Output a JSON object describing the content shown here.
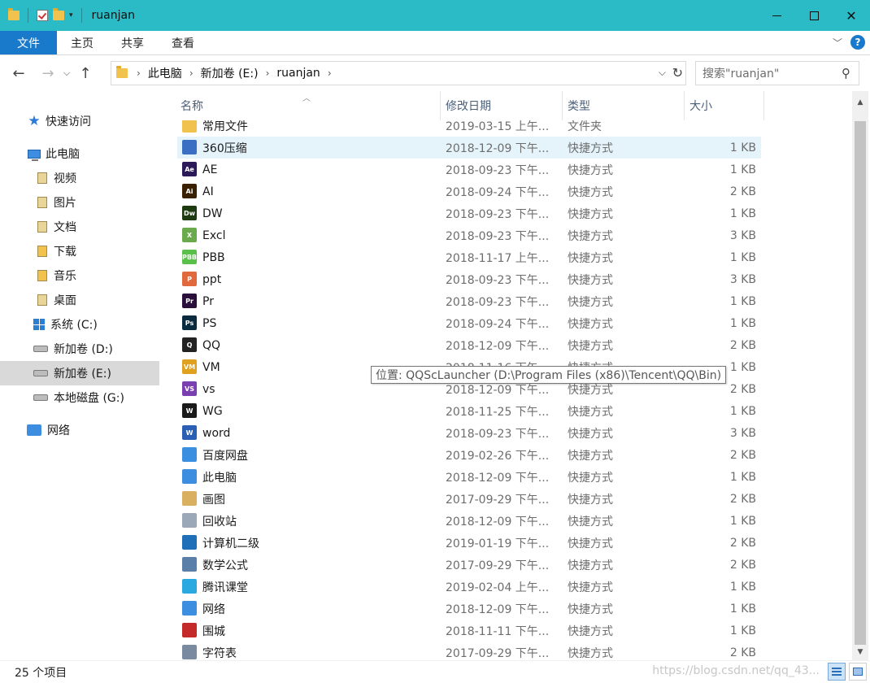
{
  "window": {
    "title": "ruanjan"
  },
  "ribbon": {
    "tabs": [
      "文件",
      "主页",
      "共享",
      "查看"
    ]
  },
  "address": {
    "crumbs": [
      "此电脑",
      "新加卷 (E:)",
      "ruanjan"
    ],
    "search_placeholder": "搜索\"ruanjan\""
  },
  "nav": {
    "quick_access": "快速访问",
    "this_pc": "此电脑",
    "items": [
      "视频",
      "图片",
      "文档",
      "下载",
      "音乐",
      "桌面"
    ],
    "drives": [
      "系统 (C:)",
      "新加卷 (D:)",
      "新加卷 (E:)",
      "本地磁盘 (G:)"
    ],
    "network": "网络"
  },
  "columns": {
    "name": "名称",
    "date": "修改日期",
    "type": "类型",
    "size": "大小"
  },
  "files": [
    {
      "name": "常用文件",
      "date": "2019-03-15 上午...",
      "type": "文件夹",
      "size": "",
      "icon": "folder",
      "color": "#f2c24f",
      "label": ""
    },
    {
      "name": "360压缩",
      "date": "2018-12-09 下午...",
      "type": "快捷方式",
      "size": "1 KB",
      "icon": "360zip-icon",
      "color": "#3a6fc4",
      "label": ""
    },
    {
      "name": "AE",
      "date": "2018-09-23 下午...",
      "type": "快捷方式",
      "size": "1 KB",
      "icon": "ae-icon",
      "color": "#2b1a57",
      "label": "Ae"
    },
    {
      "name": "AI",
      "date": "2018-09-24 下午...",
      "type": "快捷方式",
      "size": "2 KB",
      "icon": "ai-icon",
      "color": "#3a2000",
      "label": "Ai"
    },
    {
      "name": "DW",
      "date": "2018-09-23 下午...",
      "type": "快捷方式",
      "size": "1 KB",
      "icon": "dw-icon",
      "color": "#1e3a10",
      "label": "Dw"
    },
    {
      "name": "Excl",
      "date": "2018-09-23 下午...",
      "type": "快捷方式",
      "size": "3 KB",
      "icon": "excel-icon",
      "color": "#6aaa4c",
      "label": "X"
    },
    {
      "name": "PBB",
      "date": "2018-11-17 上午...",
      "type": "快捷方式",
      "size": "1 KB",
      "icon": "pbb-icon",
      "color": "#5bbf4c",
      "label": "PBB"
    },
    {
      "name": "ppt",
      "date": "2018-09-23 下午...",
      "type": "快捷方式",
      "size": "3 KB",
      "icon": "ppt-icon",
      "color": "#e0693d",
      "label": "P"
    },
    {
      "name": "Pr",
      "date": "2018-09-23 下午...",
      "type": "快捷方式",
      "size": "1 KB",
      "icon": "pr-icon",
      "color": "#2a0f3c",
      "label": "Pr"
    },
    {
      "name": "PS",
      "date": "2018-09-24 下午...",
      "type": "快捷方式",
      "size": "1 KB",
      "icon": "ps-icon",
      "color": "#0a2a40",
      "label": "Ps"
    },
    {
      "name": "QQ",
      "date": "2018-12-09 下午...",
      "type": "快捷方式",
      "size": "2 KB",
      "icon": "qq-icon",
      "color": "#222222",
      "label": "Q"
    },
    {
      "name": "VM",
      "date": "2018-11-16 下午...",
      "type": "快捷方式",
      "size": "1 KB",
      "icon": "vm-icon",
      "color": "#e0a020",
      "label": "VM"
    },
    {
      "name": "vs",
      "date": "2018-12-09 下午...",
      "type": "快捷方式",
      "size": "2 KB",
      "icon": "vs-icon",
      "color": "#7a3fb0",
      "label": "VS"
    },
    {
      "name": "WG",
      "date": "2018-11-25 下午...",
      "type": "快捷方式",
      "size": "1 KB",
      "icon": "wg-icon",
      "color": "#1a1a1a",
      "label": "W"
    },
    {
      "name": "word",
      "date": "2018-09-23 下午...",
      "type": "快捷方式",
      "size": "3 KB",
      "icon": "word-icon",
      "color": "#2b5fb4",
      "label": "W"
    },
    {
      "name": "百度网盘",
      "date": "2019-02-26 下午...",
      "type": "快捷方式",
      "size": "2 KB",
      "icon": "baidu-netdisk-icon",
      "color": "#3a8fe0",
      "label": ""
    },
    {
      "name": "此电脑",
      "date": "2018-12-09 下午...",
      "type": "快捷方式",
      "size": "1 KB",
      "icon": "computer-icon",
      "color": "#3d8ee0",
      "label": ""
    },
    {
      "name": "画图",
      "date": "2017-09-29 下午...",
      "type": "快捷方式",
      "size": "2 KB",
      "icon": "paint-icon",
      "color": "#d9b060",
      "label": ""
    },
    {
      "name": "回收站",
      "date": "2018-12-09 下午...",
      "type": "快捷方式",
      "size": "1 KB",
      "icon": "recycle-bin-icon",
      "color": "#9aa8b8",
      "label": ""
    },
    {
      "name": "计算机二级",
      "date": "2019-01-19 下午...",
      "type": "快捷方式",
      "size": "2 KB",
      "icon": "exam-icon",
      "color": "#1e6fb8",
      "label": ""
    },
    {
      "name": "数学公式",
      "date": "2017-09-29 下午...",
      "type": "快捷方式",
      "size": "2 KB",
      "icon": "math-icon",
      "color": "#5a7fa8",
      "label": ""
    },
    {
      "name": "腾讯课堂",
      "date": "2019-02-04 上午...",
      "type": "快捷方式",
      "size": "1 KB",
      "icon": "tencent-class-icon",
      "color": "#2aa8e0",
      "label": ""
    },
    {
      "name": "网络",
      "date": "2018-12-09 下午...",
      "type": "快捷方式",
      "size": "1 KB",
      "icon": "network-icon",
      "color": "#3d8ee0",
      "label": ""
    },
    {
      "name": "围城",
      "date": "2018-11-11 下午...",
      "type": "快捷方式",
      "size": "1 KB",
      "icon": "book-icon",
      "color": "#c42a2a",
      "label": ""
    },
    {
      "name": "字符表",
      "date": "2017-09-29 下午...",
      "type": "快捷方式",
      "size": "2 KB",
      "icon": "charmap-icon",
      "color": "#7a8aa0",
      "label": ""
    }
  ],
  "tooltip": "位置: QQScLauncher (D:\\Program Files (x86)\\Tencent\\QQ\\Bin)",
  "status": {
    "count": "25 个项目"
  },
  "watermark": "https://blog.csdn.net/qq_43..."
}
